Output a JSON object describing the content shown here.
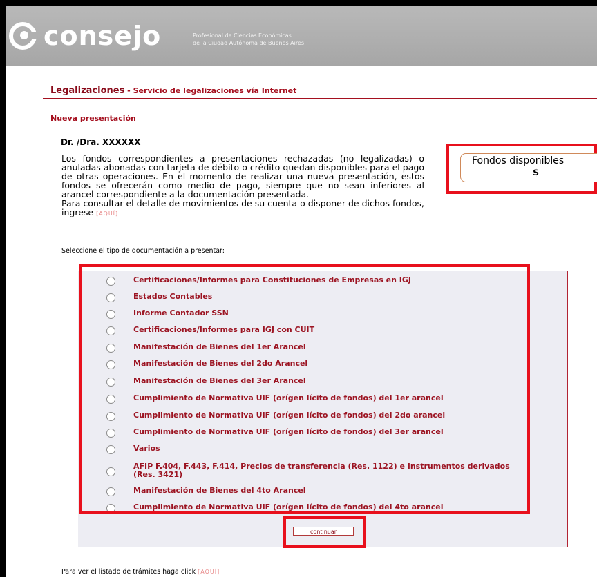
{
  "header": {
    "logo_text": "consejo",
    "logo_sub_line1": "Profesional de Ciencias Económicas",
    "logo_sub_line2": "de la Ciudad Autónoma de Buenos Aires"
  },
  "section": {
    "title": "Legalizaciones",
    "dash": " - ",
    "subtitle": "Servicio de legalizaciones vía Internet"
  },
  "nueva_presentacion": "Nueva presentación",
  "doctor": "Dr. /Dra. XXXXXX",
  "info": {
    "paragraph": "Los fondos correspondientes a presentaciones rechazadas (no legalizadas) o anuladas abonadas con tarjeta de débito o crédito quedan disponibles para el pago de otras operaciones. En el momento de realizar una nueva presentación, estos fondos se ofrecerán como medio de pago, siempre que no sean inferiores al arancel correspondiente a la documentación presentada.",
    "consult": "Para consultar el detalle de movimientos de su cuenta o disponer de dichos fondos, ingrese",
    "aqui": "[AQUÍ]"
  },
  "fondos": {
    "title": "Fondos disponibles",
    "value": "$"
  },
  "select_label": "Seleccione el tipo de documentación a presentar:",
  "options": [
    "Certificaciones/Informes para Constituciones de Empresas en IGJ",
    "Estados Contables",
    "Informe Contador SSN",
    "Certificaciones/Informes para IGJ con CUIT",
    "Manifestación de Bienes del 1er Arancel",
    "Manifestación de Bienes del 2do Arancel",
    "Manifestación de Bienes del 3er Arancel",
    "Cumplimiento de Normativa UIF (orígen lícito de fondos) del 1er arancel",
    "Cumplimiento de Normativa UIF (orígen lícito de fondos) del 2do arancel",
    "Cumplimiento de Normativa UIF (orígen lícito de fondos) del 3er arancel",
    "Varios",
    "AFIP F.404, F.443, F.414, Precios de transferencia (Res. 1122) e Instrumentos derivados (Res. 3421)",
    "Manifestación de Bienes del 4to Arancel",
    "Cumplimiento de Normativa UIF (orígen lícito de fondos) del 4to arancel"
  ],
  "continuar_label": "continuar",
  "footer": {
    "text": "Para ver el listado de trámites haga click",
    "aqui": "[AQUÍ]"
  },
  "colors": {
    "accent": "#a5101f",
    "highlight": "#e8101c",
    "header_gray": "#b0b0b0",
    "panel_bg": "#ededf3"
  }
}
